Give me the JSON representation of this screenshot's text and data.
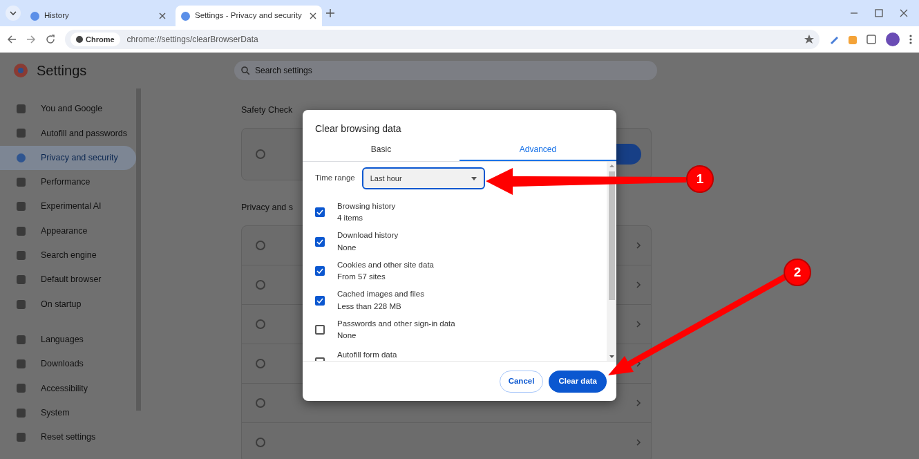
{
  "browser": {
    "tabs": [
      {
        "title": "History",
        "selected": false
      },
      {
        "title": "Settings - Privacy and security",
        "selected": true
      }
    ],
    "address_chip": "Chrome",
    "url": "chrome://settings/clearBrowserData"
  },
  "settings": {
    "title": "Settings",
    "search_placeholder": "Search settings",
    "sidebar_groups": [
      [
        {
          "label": "You and Google",
          "selected": false
        },
        {
          "label": "Autofill and passwords",
          "selected": false
        },
        {
          "label": "Privacy and security",
          "selected": true
        },
        {
          "label": "Performance",
          "selected": false
        },
        {
          "label": "Experimental AI",
          "selected": false
        },
        {
          "label": "Appearance",
          "selected": false
        },
        {
          "label": "Search engine",
          "selected": false
        },
        {
          "label": "Default browser",
          "selected": false
        },
        {
          "label": "On startup",
          "selected": false
        }
      ],
      [
        {
          "label": "Languages",
          "selected": false
        },
        {
          "label": "Downloads",
          "selected": false
        },
        {
          "label": "Accessibility",
          "selected": false
        },
        {
          "label": "System",
          "selected": false
        },
        {
          "label": "Reset settings",
          "selected": false
        }
      ]
    ],
    "sections": [
      {
        "heading": "Safety Check"
      },
      {
        "heading": "Privacy and s"
      }
    ]
  },
  "dialog": {
    "title": "Clear browsing data",
    "tabs": [
      {
        "label": "Basic",
        "selected": false
      },
      {
        "label": "Advanced",
        "selected": true
      }
    ],
    "time_range": {
      "label": "Time range",
      "value": "Last hour"
    },
    "items": [
      {
        "label": "Browsing history",
        "detail": "4 items",
        "checked": true
      },
      {
        "label": "Download history",
        "detail": "None",
        "checked": true
      },
      {
        "label": "Cookies and other site data",
        "detail": "From 57 sites",
        "checked": true
      },
      {
        "label": "Cached images and files",
        "detail": "Less than 228 MB",
        "checked": true
      },
      {
        "label": "Passwords and other sign-in data",
        "detail": "None",
        "checked": false
      },
      {
        "label": "Autofill form data",
        "checked": false
      }
    ],
    "buttons": {
      "cancel": "Cancel",
      "confirm": "Clear data"
    }
  },
  "annotations": [
    {
      "number": "1"
    },
    {
      "number": "2"
    }
  ]
}
